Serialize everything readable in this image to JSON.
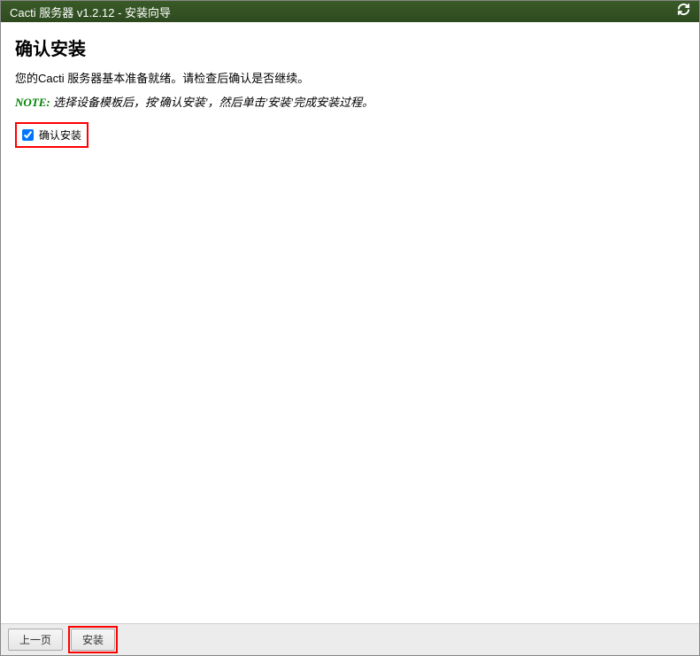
{
  "titleBar": {
    "text": "Cacti 服务器 v1.2.12 - 安装向导"
  },
  "content": {
    "heading": "确认安装",
    "description": "您的Cacti 服务器基本准备就绪。请检查后确认是否继续。",
    "noteLabel": "NOTE:",
    "noteText": "选择设备模板后，按'确认安装'，然后单击'安装'完成安装过程。",
    "checkboxLabel": "确认安装",
    "checkboxChecked": true
  },
  "footer": {
    "prevButton": "上一页",
    "installButton": "安装"
  }
}
